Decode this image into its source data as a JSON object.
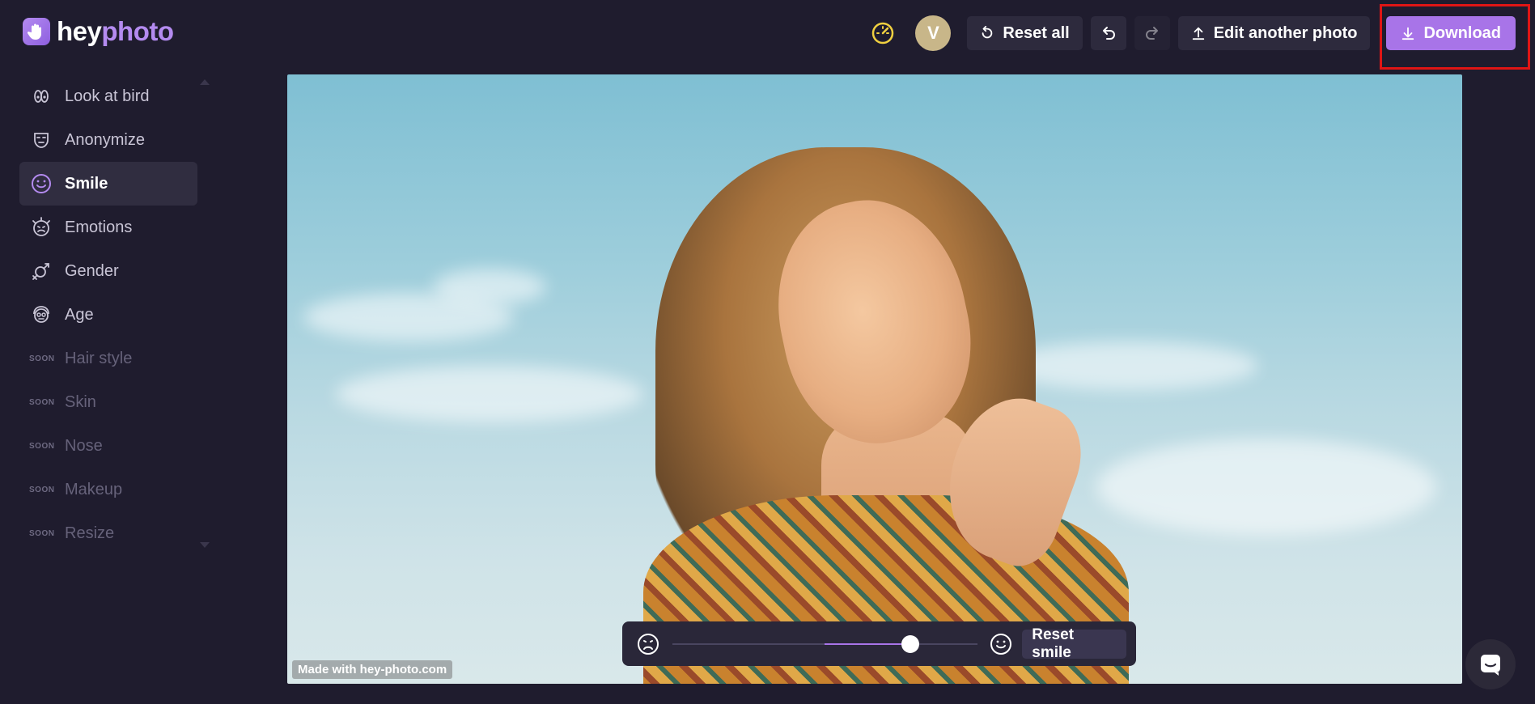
{
  "brand": {
    "part1": "hey",
    "part2": "photo",
    "accent": "#b48bf0"
  },
  "header": {
    "gauge_icon": "gauge-icon",
    "avatar_initial": "V",
    "reset_all_label": "Reset all",
    "edit_another_label": "Edit another photo",
    "download_label": "Download",
    "download_color": "#a874e8"
  },
  "sidebar": {
    "items": [
      {
        "label": "Look at bird",
        "icon": "eyes-icon",
        "soon": false,
        "active": false
      },
      {
        "label": "Anonymize",
        "icon": "mask-icon",
        "soon": false,
        "active": false
      },
      {
        "label": "Smile",
        "icon": "smile-icon",
        "soon": false,
        "active": true
      },
      {
        "label": "Emotions",
        "icon": "emotions-icon",
        "soon": false,
        "active": false
      },
      {
        "label": "Gender",
        "icon": "gender-icon",
        "soon": false,
        "active": false
      },
      {
        "label": "Age",
        "icon": "age-icon",
        "soon": false,
        "active": false
      },
      {
        "label": "Hair style",
        "soon": true
      },
      {
        "label": "Skin",
        "soon": true
      },
      {
        "label": "Nose",
        "soon": true
      },
      {
        "label": "Makeup",
        "soon": true
      },
      {
        "label": "Resize",
        "soon": true
      }
    ],
    "soon_tag": "SOON"
  },
  "photo": {
    "watermark": "Made with hey-photo.com"
  },
  "smile_control": {
    "reset_label": "Reset smile",
    "slider_value_percent": 78,
    "slider_fill_start_percent": 50
  }
}
